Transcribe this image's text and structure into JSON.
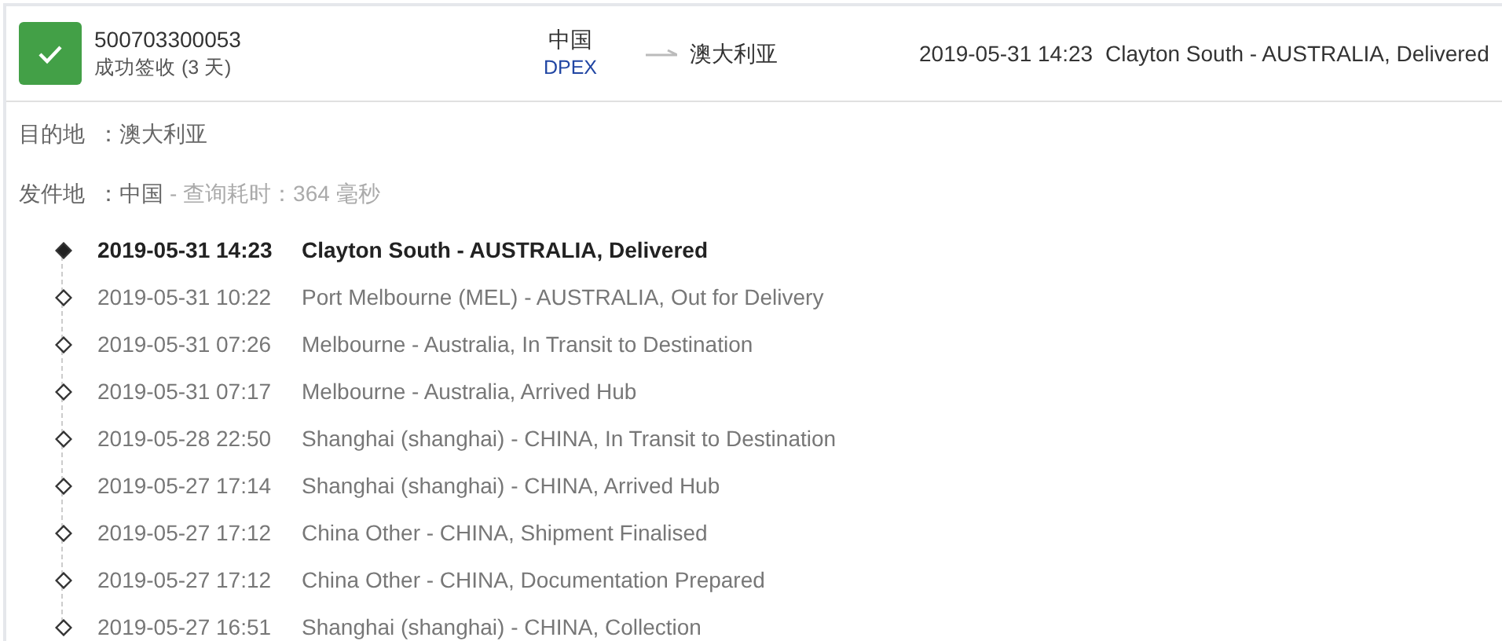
{
  "shipment": {
    "delivered": true,
    "tracking_number": "500703300053",
    "status_text": "成功签收 (3 天)",
    "origin": "中国",
    "carrier": "DPEX",
    "destination": "澳大利亚",
    "latest_time": "2019-05-31 14:23",
    "latest_event": "Clayton South - AUSTRALIA, Delivered"
  },
  "destination_line": {
    "label": "目的地",
    "value": "：澳大利亚"
  },
  "origin_line": {
    "label": "发件地",
    "value": "：中国",
    "note": "- 查询耗时：364 毫秒"
  },
  "events": [
    {
      "time": "2019-05-31 14:23",
      "description": "Clayton South - AUSTRALIA, Delivered",
      "current": true
    },
    {
      "time": "2019-05-31 10:22",
      "description": "Port Melbourne (MEL) - AUSTRALIA, Out for Delivery",
      "current": false
    },
    {
      "time": "2019-05-31 07:26",
      "description": "Melbourne - Australia, In Transit to Destination",
      "current": false
    },
    {
      "time": "2019-05-31 07:17",
      "description": "Melbourne - Australia, Arrived Hub",
      "current": false
    },
    {
      "time": "2019-05-28 22:50",
      "description": "Shanghai (shanghai) - CHINA, In Transit to Destination",
      "current": false
    },
    {
      "time": "2019-05-27 17:14",
      "description": "Shanghai (shanghai) - CHINA, Arrived Hub",
      "current": false
    },
    {
      "time": "2019-05-27 17:12",
      "description": "China Other - CHINA, Shipment Finalised",
      "current": false
    },
    {
      "time": "2019-05-27 17:12",
      "description": "China Other - CHINA, Documentation Prepared",
      "current": false
    },
    {
      "time": "2019-05-27 16:51",
      "description": "Shanghai (shanghai) - CHINA, Collection",
      "current": false
    }
  ]
}
